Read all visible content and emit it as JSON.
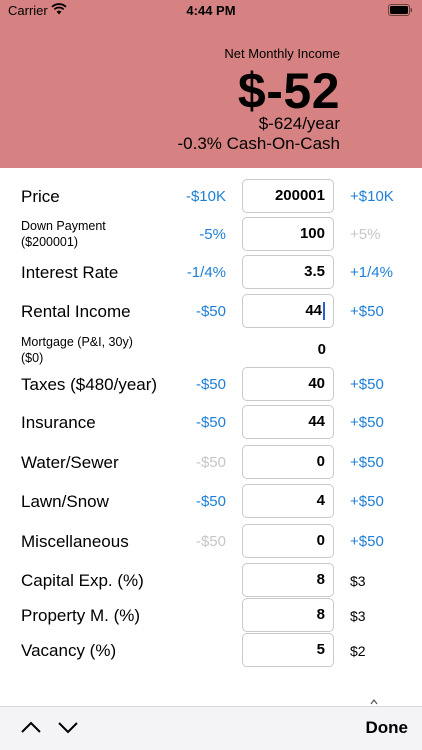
{
  "status_bar": {
    "carrier": "Carrier",
    "time": "4:44 PM"
  },
  "summary": {
    "net_label": "Net Monthly Income",
    "net_amount": "$-52",
    "per_year": "$-624/year",
    "cash_on_cash": "-0.3% Cash-On-Cash"
  },
  "rows": {
    "price": {
      "label": "Price",
      "minus": "-$10K",
      "value": "200001",
      "plus": "+$10K"
    },
    "down_payment": {
      "label1": "Down Payment",
      "label2": "($200001)",
      "minus": "-5%",
      "value": "100",
      "plus": "+5%"
    },
    "interest": {
      "label": "Interest Rate",
      "minus": "-1/4%",
      "value": "3.5",
      "plus": "+1/4%"
    },
    "rental": {
      "label": "Rental Income",
      "minus": "-$50",
      "value": "44",
      "plus": "+$50"
    },
    "mortgage": {
      "label1": "Mortgage (P&I, 30y)",
      "label2": "($0)",
      "value": "0"
    },
    "taxes": {
      "label": "Taxes ($480/year)",
      "minus": "-$50",
      "value": "40",
      "plus": "+$50"
    },
    "insurance": {
      "label": "Insurance",
      "minus": "-$50",
      "value": "44",
      "plus": "+$50"
    },
    "water": {
      "label": "Water/Sewer",
      "minus": "-$50",
      "value": "0",
      "plus": "+$50"
    },
    "lawn": {
      "label": "Lawn/Snow",
      "minus": "-$50",
      "value": "4",
      "plus": "+$50"
    },
    "misc": {
      "label": "Miscellaneous",
      "minus": "-$50",
      "value": "0",
      "plus": "+$50"
    },
    "capex": {
      "label": "Capital Exp. (%)",
      "value": "8",
      "amount": "$3"
    },
    "property_m": {
      "label": "Property M. (%)",
      "value": "8",
      "amount": "$3"
    },
    "vacancy": {
      "label": "Vacancy (%)",
      "value": "5",
      "amount": "$2"
    }
  },
  "toolbar": {
    "done": "Done"
  },
  "colors": {
    "header_bg": "#d68282",
    "accent": "#1f7fd6",
    "disabled": "#c6c6c8"
  }
}
